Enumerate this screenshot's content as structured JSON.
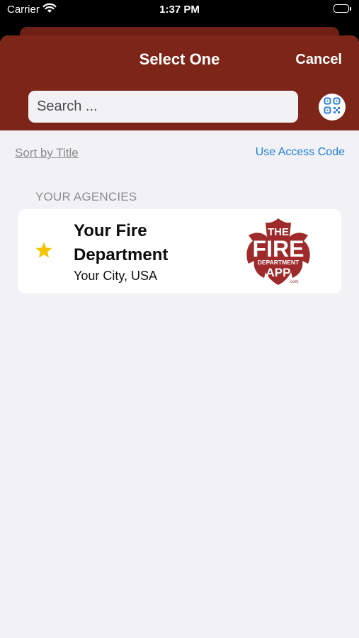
{
  "status_bar": {
    "carrier": "Carrier",
    "time": "1:37 PM"
  },
  "header": {
    "title": "Select One",
    "cancel_label": "Cancel",
    "search_placeholder": "Search ..."
  },
  "controls": {
    "sort_label": "Sort by Title",
    "access_code_label": "Use Access Code"
  },
  "section_header": "YOUR AGENCIES",
  "agencies": [
    {
      "name": "Your Fire Department",
      "location": "Your City, USA",
      "favorite": true,
      "logo_text": {
        "line1": "THE",
        "line2": "FIRE",
        "line3": "DEPARTMENT",
        "line4": "APP",
        "domain": ".com"
      }
    }
  ],
  "colors": {
    "header_bg": "#7d2518",
    "accent_link": "#1f7fd6",
    "star": "#f5c400",
    "logo_red": "#9e2a2b"
  },
  "icons": {
    "wifi": "wifi-icon",
    "battery": "battery-icon",
    "qr": "qr-code-icon",
    "star": "star-icon"
  }
}
